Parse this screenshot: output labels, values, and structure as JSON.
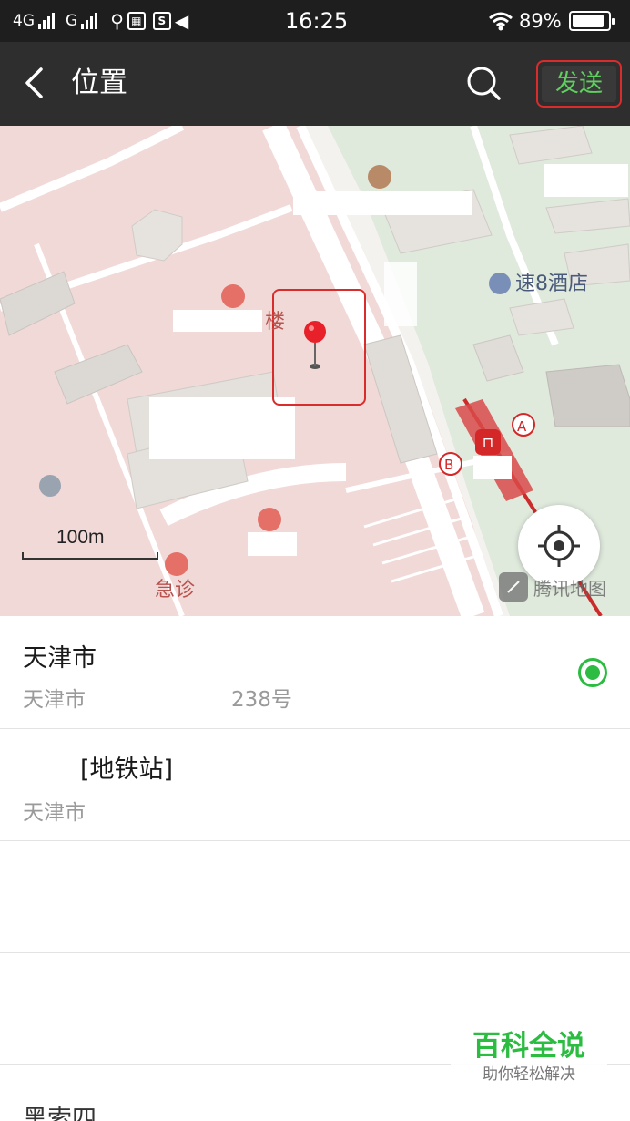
{
  "status_bar": {
    "network_1": "4G",
    "network_2": "G",
    "time": "16:25",
    "battery_percent": "89%",
    "battery_level": 0.89,
    "icons": [
      "usb-icon",
      "notification-icon",
      "s-app-icon",
      "mute-icon",
      "wifi-icon"
    ]
  },
  "title_bar": {
    "title": "位置",
    "send_label": "发送",
    "icons": [
      "back-arrow-icon",
      "search-icon"
    ]
  },
  "map": {
    "labels": {
      "hotel": "速8酒店",
      "building": "楼",
      "emergency": "急诊",
      "exit_a": "A",
      "exit_b": "B"
    },
    "scale": "100m",
    "provider": "腾讯地图",
    "colors": {
      "hospital_area": "#f1d9d7",
      "park_area": "#dfe9dc",
      "metro_line": "#cc2b2b",
      "pin": "#e8202a"
    }
  },
  "places": [
    {
      "name": "天津市",
      "address_start": "天津市",
      "address_end": "238号",
      "selected": true
    },
    {
      "name": "[地铁站]",
      "address_start": "天津市",
      "selected": false
    },
    {
      "name": "",
      "address_start": ""
    },
    {
      "name": "",
      "address_start": ""
    }
  ],
  "partial_next_item": "黑索四",
  "watermark": {
    "title": "百科全说",
    "subtitle": "助你轻松解决"
  }
}
